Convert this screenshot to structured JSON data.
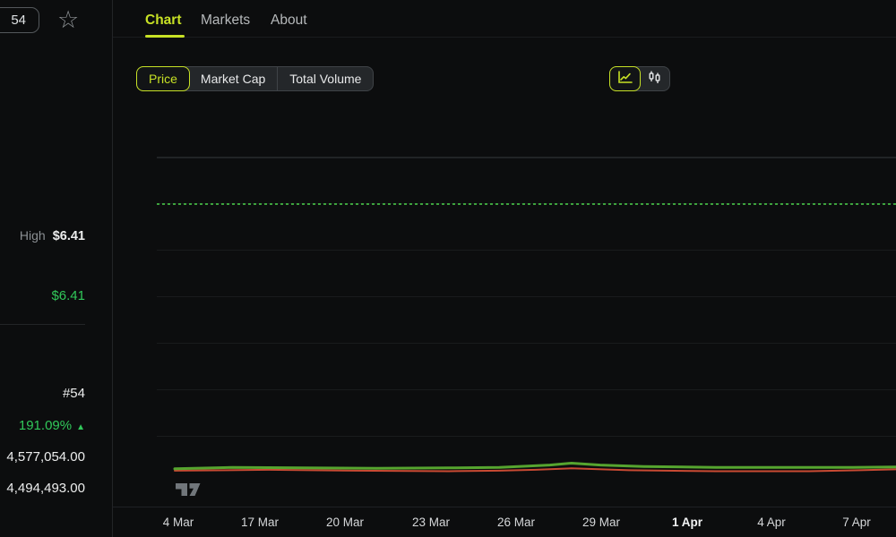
{
  "colors": {
    "background": "#0c0d0e",
    "accent": "#c7e125",
    "positive_green": "#31c85a",
    "line_green": "#56a52f",
    "line_red": "#c94a33",
    "reference_dash_green": "#3da33d"
  },
  "sidebar": {
    "rank_badge": "54",
    "star_icon": "star-outline",
    "high_label": "High",
    "high_value": "$6.41",
    "current_price": "$6.41",
    "rank": "#54",
    "change_percent": "191.09%",
    "change_arrow": "▲",
    "stat_value_1": "4,577,054.00",
    "stat_value_2": "4,494,493.00"
  },
  "tabs": [
    {
      "label": "Chart",
      "active": true
    },
    {
      "label": "Markets",
      "active": false
    },
    {
      "label": "About",
      "active": false
    }
  ],
  "metric_toggle": [
    {
      "label": "Price",
      "active": true
    },
    {
      "label": "Market Cap",
      "active": false
    },
    {
      "label": "Total Volume",
      "active": false
    }
  ],
  "chart_type_toggle": [
    {
      "icon": "line-chart-icon",
      "active": true
    },
    {
      "icon": "candlestick-icon",
      "active": false
    }
  ],
  "attribution": {
    "logo": "tradingview-logo"
  },
  "chart_data": {
    "type": "line",
    "title": "",
    "xlabel": "",
    "ylabel": "",
    "grid": "horizontal",
    "legend": false,
    "ylim": [
      0,
      7.7
    ],
    "x_ticks": [
      {
        "label": "4 Mar",
        "bold": false
      },
      {
        "label": "17 Mar",
        "bold": false
      },
      {
        "label": "20 Mar",
        "bold": false
      },
      {
        "label": "23 Mar",
        "bold": false
      },
      {
        "label": "26 Mar",
        "bold": false
      },
      {
        "label": "29 Mar",
        "bold": false
      },
      {
        "label": "1 Apr",
        "bold": true
      },
      {
        "label": "4 Apr",
        "bold": false
      },
      {
        "label": "7 Apr",
        "bold": false
      }
    ],
    "reference_line": {
      "value": 6.41,
      "style": "dashed",
      "color": "#3da33d"
    },
    "series": [
      {
        "name": "price",
        "color": "#56a52f",
        "stroke_width": 3,
        "points": [
          [
            0,
            0.8
          ],
          [
            0.08,
            0.83
          ],
          [
            0.18,
            0.82
          ],
          [
            0.28,
            0.81
          ],
          [
            0.38,
            0.82
          ],
          [
            0.45,
            0.83
          ],
          [
            0.52,
            0.88
          ],
          [
            0.55,
            0.92
          ],
          [
            0.59,
            0.88
          ],
          [
            0.65,
            0.85
          ],
          [
            0.75,
            0.83
          ],
          [
            0.85,
            0.83
          ],
          [
            0.94,
            0.83
          ],
          [
            1,
            0.84
          ]
        ]
      },
      {
        "name": "price-secondary",
        "color": "#c94a33",
        "stroke_width": 2,
        "points": [
          [
            0,
            0.76
          ],
          [
            0.13,
            0.78
          ],
          [
            0.25,
            0.76
          ],
          [
            0.38,
            0.75
          ],
          [
            0.45,
            0.76
          ],
          [
            0.5,
            0.78
          ],
          [
            0.55,
            0.81
          ],
          [
            0.63,
            0.77
          ],
          [
            0.75,
            0.75
          ],
          [
            0.88,
            0.75
          ],
          [
            0.95,
            0.77
          ],
          [
            1,
            0.79
          ]
        ]
      }
    ]
  }
}
